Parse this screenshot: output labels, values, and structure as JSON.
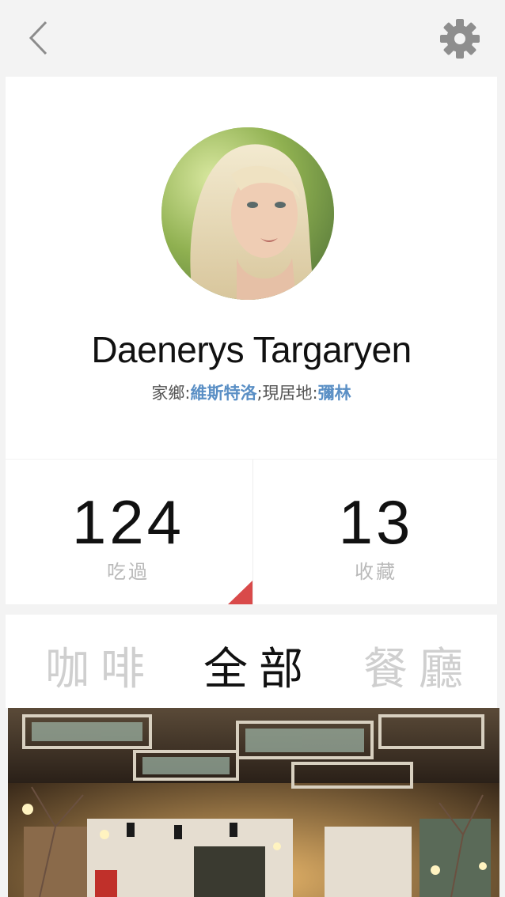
{
  "header": {
    "back_icon": "chevron-left-icon",
    "settings_icon": "gear-icon"
  },
  "profile": {
    "name": "Daenerys Targaryen",
    "hometown_label": "家鄉:",
    "hometown_value": "維斯特洛",
    "separator": ";",
    "residence_label": "現居地:",
    "residence_value": "彌林",
    "link_color": "#5a8fc5"
  },
  "stats": {
    "eaten_count": "124",
    "eaten_label": "吃過",
    "favorites_count": "13",
    "favorites_label": "收藏",
    "accent_color": "#d94a4a"
  },
  "tabs": {
    "coffee": "咖啡",
    "all": "全部",
    "restaurant": "餐廳",
    "active": "all"
  }
}
